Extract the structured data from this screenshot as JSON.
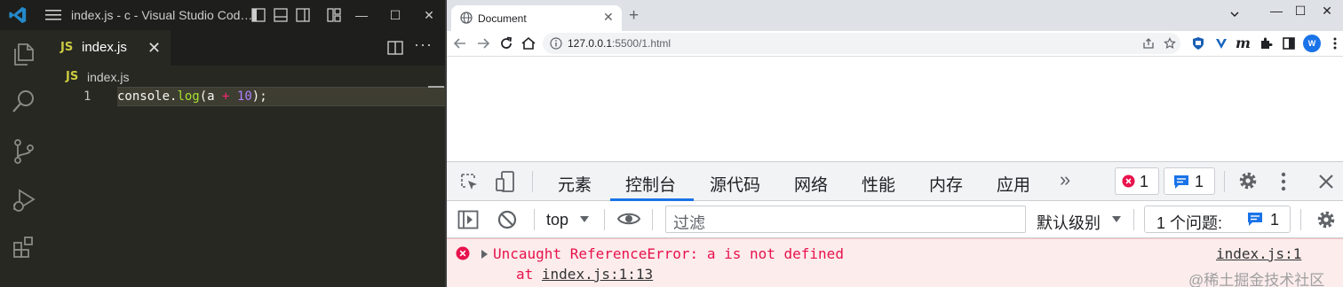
{
  "vscode": {
    "window_title": "index.js - c - Visual Studio Cod…",
    "tab": {
      "icon_text": "JS",
      "label": "index.js",
      "close": "✕"
    },
    "breadcrumb": {
      "icon_text": "JS",
      "file": "index.js"
    },
    "editor": {
      "line_number": "1",
      "code_tokens": {
        "obj": "console",
        "dot": ".",
        "fn": "log",
        "open": "(a ",
        "op": "+",
        "sp": " ",
        "num": "10",
        "close": ");"
      }
    },
    "window_controls": {
      "minimize": "—",
      "maximize": "☐",
      "close": "✕"
    },
    "more_label": "···",
    "activity_icons": [
      "explorer-icon",
      "search-icon",
      "source-control-icon",
      "run-debug-icon",
      "extensions-icon"
    ]
  },
  "browser": {
    "tab_title": "Document",
    "tab_close": "✕",
    "new_tab": "+",
    "window_controls": {
      "minimize": "—",
      "maximize": "☐",
      "close": "✕"
    },
    "url_host": "127.0.0.1",
    "url_rest": ":5500/1.html",
    "avatar": "W",
    "ext_m": "m"
  },
  "devtools": {
    "tabs": [
      "元素",
      "控制台",
      "源代码",
      "网络",
      "性能",
      "内存",
      "应用"
    ],
    "active_tab": "控制台",
    "more_tabs": "»",
    "error_count": "1",
    "issue_count": "1",
    "context": "top",
    "filter_placeholder": "过滤",
    "levels": "默认级别",
    "issues_label": "1 个问题:",
    "issues_count": "1",
    "console": {
      "error_message": "Uncaught ReferenceError: a is not defined",
      "at_prefix": "at ",
      "at_source": "index.js:1:13",
      "source_link": "index.js:1"
    },
    "accent": "#1a73e8",
    "error_color": "#e8124c"
  },
  "watermark": "@稀土掘金技术社区"
}
